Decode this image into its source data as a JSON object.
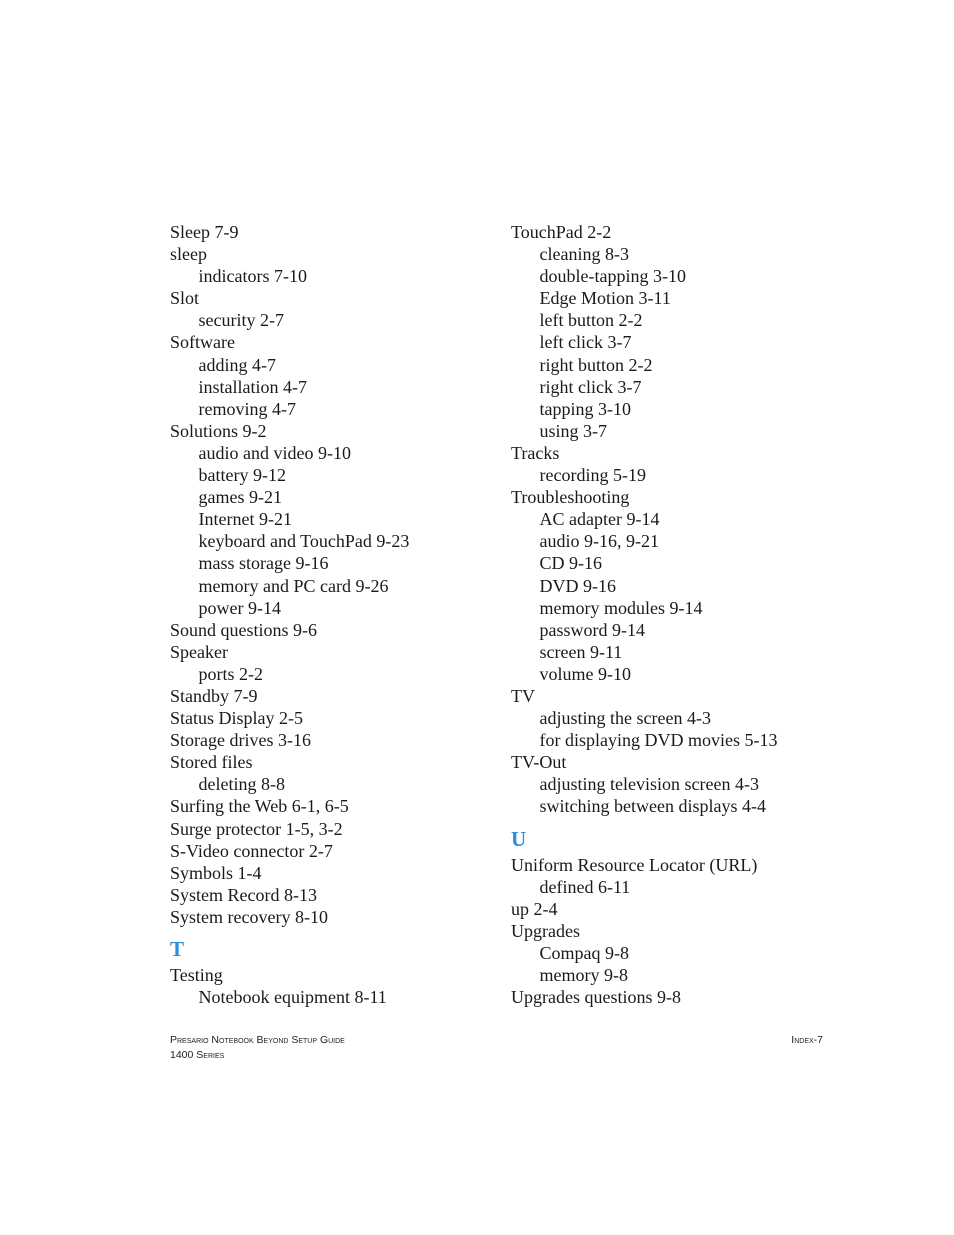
{
  "index": {
    "left_column": [
      {
        "type": "main",
        "text": "Sleep 7-9"
      },
      {
        "type": "main",
        "text": "sleep"
      },
      {
        "type": "sub",
        "text": "indicators 7-10"
      },
      {
        "type": "main",
        "text": "Slot"
      },
      {
        "type": "sub",
        "text": "security 2-7"
      },
      {
        "type": "main",
        "text": "Software"
      },
      {
        "type": "sub",
        "text": "adding 4-7"
      },
      {
        "type": "sub",
        "text": "installation 4-7"
      },
      {
        "type": "sub",
        "text": "removing 4-7"
      },
      {
        "type": "main",
        "text": "Solutions 9-2"
      },
      {
        "type": "sub",
        "text": "audio and video 9-10"
      },
      {
        "type": "sub",
        "text": "battery 9-12"
      },
      {
        "type": "sub",
        "text": "games 9-21"
      },
      {
        "type": "sub",
        "text": "Internet 9-21"
      },
      {
        "type": "sub",
        "text": "keyboard and TouchPad 9-23"
      },
      {
        "type": "sub",
        "text": "mass storage 9-16"
      },
      {
        "type": "sub",
        "text": "memory and PC card 9-26"
      },
      {
        "type": "sub",
        "text": "power 9-14"
      },
      {
        "type": "main",
        "text": "Sound questions 9-6"
      },
      {
        "type": "main",
        "text": "Speaker"
      },
      {
        "type": "sub",
        "text": "ports 2-2"
      },
      {
        "type": "main",
        "text": "Standby 7-9"
      },
      {
        "type": "main",
        "text": "Status Display 2-5"
      },
      {
        "type": "main",
        "text": "Storage drives 3-16"
      },
      {
        "type": "main",
        "text": "Stored files"
      },
      {
        "type": "sub",
        "text": "deleting 8-8"
      },
      {
        "type": "main",
        "text": "Surfing the Web 6-1, 6-5"
      },
      {
        "type": "main",
        "text": "Surge protector 1-5, 3-2"
      },
      {
        "type": "main",
        "text": "S-Video connector 2-7"
      },
      {
        "type": "main",
        "text": "Symbols 1-4"
      },
      {
        "type": "main",
        "text": "System Record 8-13"
      },
      {
        "type": "main",
        "text": "System recovery 8-10"
      },
      {
        "type": "letter",
        "text": "T"
      },
      {
        "type": "main",
        "text": "Testing"
      },
      {
        "type": "sub",
        "text": "Notebook equipment 8-11"
      }
    ],
    "right_column": [
      {
        "type": "main",
        "text": "TouchPad 2-2"
      },
      {
        "type": "sub",
        "text": "cleaning 8-3"
      },
      {
        "type": "sub",
        "text": "double-tapping 3-10"
      },
      {
        "type": "sub",
        "text": "Edge Motion 3-11"
      },
      {
        "type": "sub",
        "text": "left button 2-2"
      },
      {
        "type": "sub",
        "text": "left click 3-7"
      },
      {
        "type": "sub",
        "text": "right button 2-2"
      },
      {
        "type": "sub",
        "text": "right click 3-7"
      },
      {
        "type": "sub",
        "text": "tapping 3-10"
      },
      {
        "type": "sub",
        "text": "using 3-7"
      },
      {
        "type": "main",
        "text": "Tracks"
      },
      {
        "type": "sub",
        "text": "recording 5-19"
      },
      {
        "type": "main",
        "text": "Troubleshooting"
      },
      {
        "type": "sub",
        "text": "AC adapter 9-14"
      },
      {
        "type": "sub",
        "text": "audio 9-16, 9-21"
      },
      {
        "type": "sub",
        "text": "CD 9-16"
      },
      {
        "type": "sub",
        "text": "DVD 9-16"
      },
      {
        "type": "sub",
        "text": "memory modules 9-14"
      },
      {
        "type": "sub",
        "text": "password 9-14"
      },
      {
        "type": "sub",
        "text": "screen 9-11"
      },
      {
        "type": "sub",
        "text": "volume 9-10"
      },
      {
        "type": "main",
        "text": "TV"
      },
      {
        "type": "sub",
        "text": "adjusting the screen 4-3"
      },
      {
        "type": "sub",
        "text": "for displaying DVD movies 5-13"
      },
      {
        "type": "main",
        "text": "TV-Out"
      },
      {
        "type": "sub",
        "text": "adjusting television screen 4-3"
      },
      {
        "type": "sub",
        "text": "switching between displays 4-4"
      },
      {
        "type": "letter",
        "text": "U"
      },
      {
        "type": "main",
        "text": "Uniform Resource Locator (URL)"
      },
      {
        "type": "sub",
        "text": "defined 6-11"
      },
      {
        "type": "main",
        "text": "up 2-4"
      },
      {
        "type": "main",
        "text": "Upgrades"
      },
      {
        "type": "sub",
        "text": "Compaq 9-8"
      },
      {
        "type": "sub",
        "text": "memory 9-8"
      },
      {
        "type": "main",
        "text": "Upgrades questions 9-8"
      }
    ]
  },
  "footer": {
    "book_title": "Presario Notebook Beyond Setup Guide",
    "series": "1400 Series",
    "page_label": "Index-7"
  },
  "colors": {
    "letter_heading": "#2a8fd4",
    "body_text": "#1a1a1a"
  }
}
